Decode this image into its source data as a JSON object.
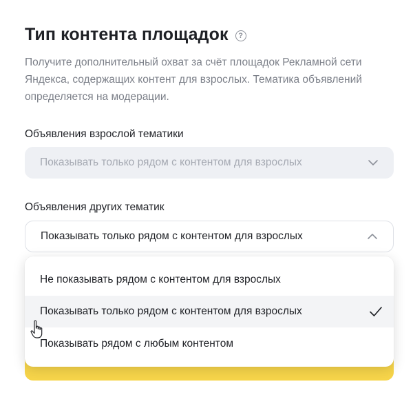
{
  "section": {
    "title": "Тип контента площадок",
    "help_icon": "question-circle-icon",
    "description": "Получите дополнительный охват за счёт площадок Рекламной сети Яндекса, содержащих контент для взрослых. Тематика объявлений определяется на модерации."
  },
  "adult_ads": {
    "label": "Объявления взрослой тематики",
    "value": "Показывать только рядом с контентом для взрослых",
    "state": "disabled"
  },
  "other_ads": {
    "label": "Объявления других тематик",
    "value": "Показывать только рядом с контентом для взрослых",
    "state": "open"
  },
  "dropdown": {
    "options": [
      {
        "label": "Не показывать рядом с контентом для взрослых",
        "selected": false
      },
      {
        "label": "Показывать только рядом с контентом для взрослых",
        "selected": true
      },
      {
        "label": "Показывать рядом с любым контентом",
        "selected": false
      }
    ]
  },
  "colors": {
    "accent_yellow": "#f7d54a",
    "text_primary": "#1f2126",
    "text_secondary": "#7b7f88"
  }
}
